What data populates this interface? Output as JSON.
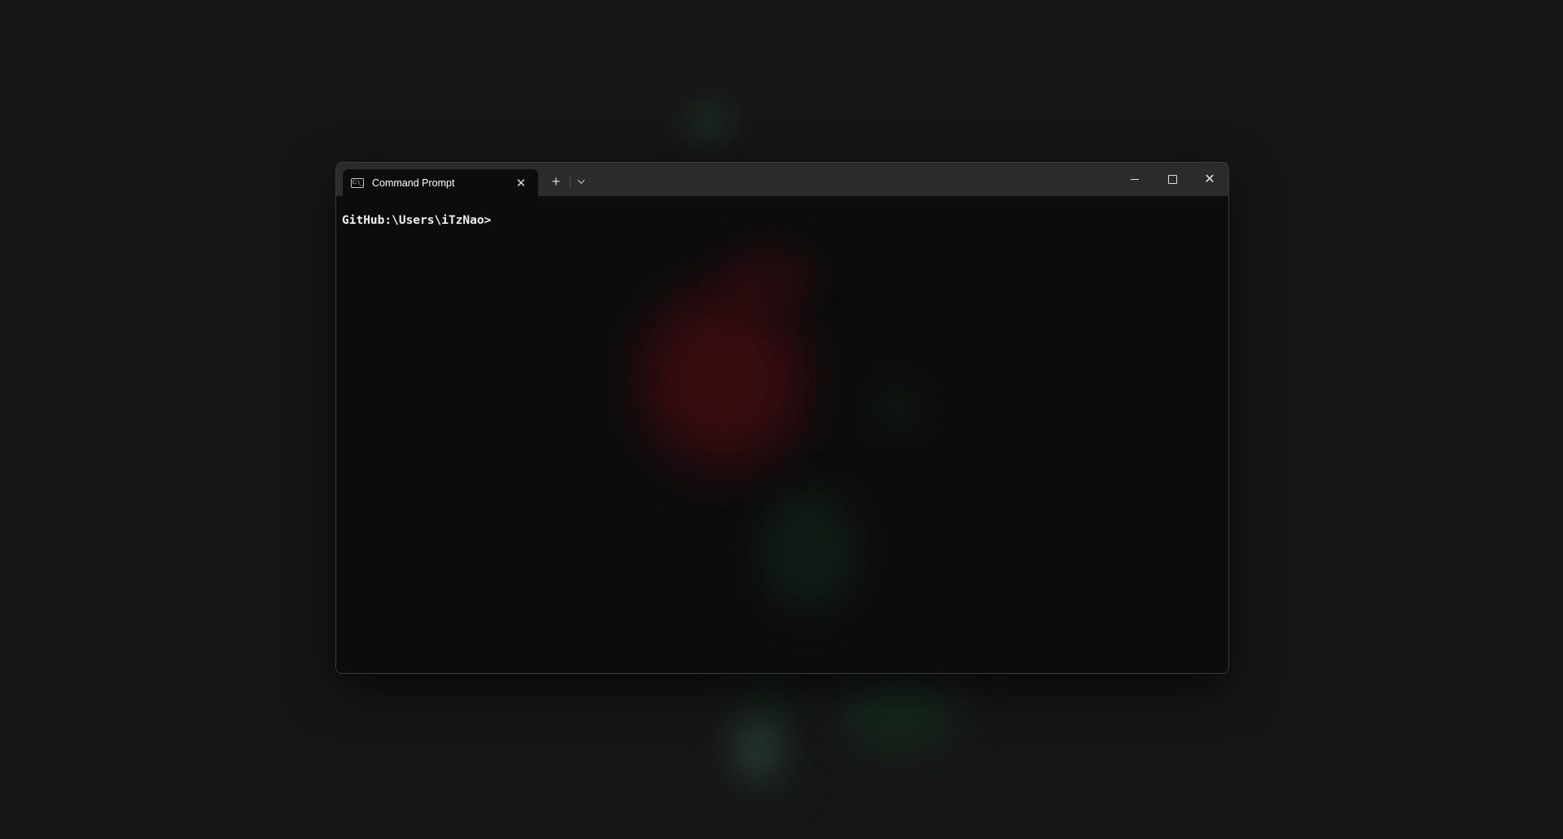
{
  "window": {
    "tabs": [
      {
        "label": "Command Prompt",
        "icon": "cmd-icon",
        "icon_text": "C:\\_",
        "active": true
      }
    ],
    "close_tab_glyph": "✕",
    "new_tab_glyph": "+",
    "controls": {
      "minimize": "minimize-icon",
      "maximize": "maximize-icon",
      "close": "close-icon",
      "close_glyph": "✕"
    }
  },
  "terminal": {
    "prompt": "GitHub:\\Users\\iTzNao>"
  },
  "colors": {
    "titlebar": "#2b2b2b",
    "terminal_bg": "#0c0c0c",
    "text": "#f2f2f2",
    "desktop_bg": "#161616"
  }
}
